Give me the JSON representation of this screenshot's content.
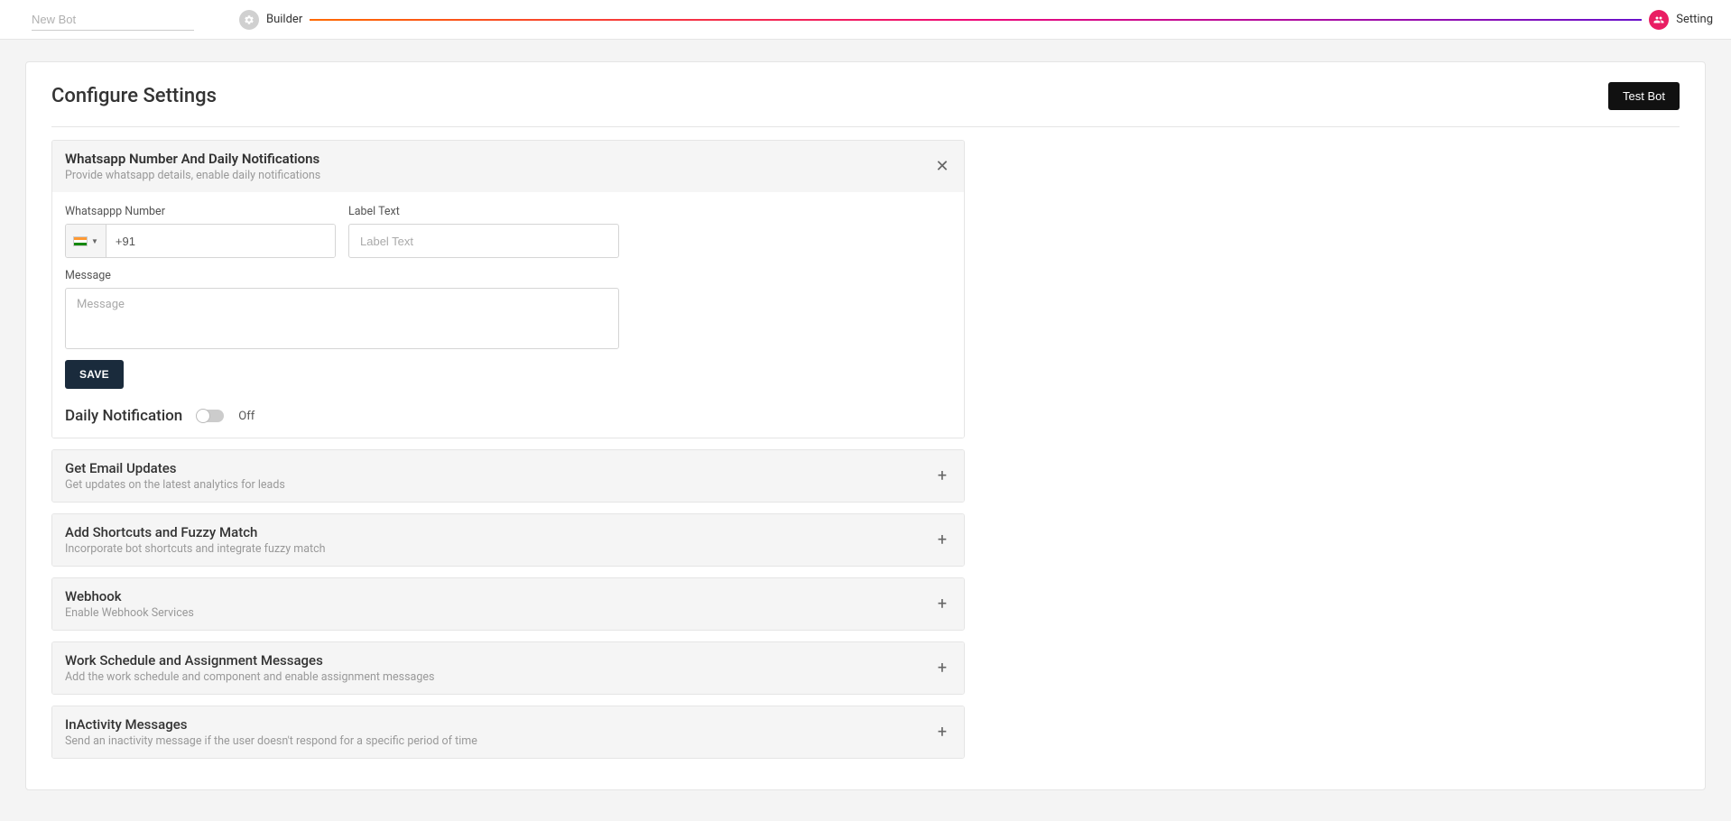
{
  "header": {
    "botNamePlaceholder": "New Bot",
    "builderLabel": "Builder",
    "settingLabel": "Setting"
  },
  "page": {
    "title": "Configure Settings",
    "testBotLabel": "Test Bot"
  },
  "sections": {
    "whatsapp": {
      "title": "Whatsapp Number And Daily Notifications",
      "subtitle": "Provide whatsapp details, enable daily notifications",
      "fields": {
        "phoneLabel": "Whatsappp Number",
        "phonePrefix": "+91",
        "labelTextLabel": "Label Text",
        "labelTextPlaceholder": "Label Text",
        "messageLabel": "Message",
        "messagePlaceholder": "Message"
      },
      "saveLabel": "SAVE",
      "notificationLabel": "Daily Notification",
      "notificationState": "Off"
    },
    "email": {
      "title": "Get Email Updates",
      "subtitle": "Get updates on the latest analytics for leads"
    },
    "shortcuts": {
      "title": "Add Shortcuts and Fuzzy Match",
      "subtitle": "Incorporate bot shortcuts and integrate fuzzy match"
    },
    "webhook": {
      "title": "Webhook",
      "subtitle": "Enable Webhook Services"
    },
    "workSchedule": {
      "title": "Work Schedule and Assignment Messages",
      "subtitle": "Add the work schedule and component and enable assignment messages"
    },
    "inactivity": {
      "title": "InActivity Messages",
      "subtitle": "Send an inactivity message if the user doesn't respond for a specific period of time"
    }
  }
}
